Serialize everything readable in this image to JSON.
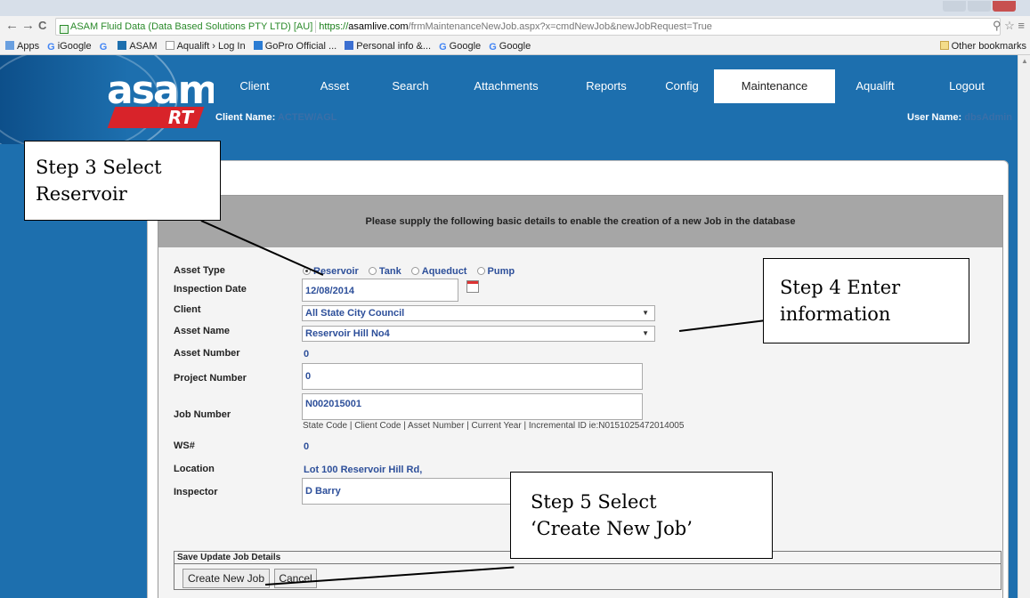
{
  "browser": {
    "ev_label": "ASAM Fluid Data (Data Based Solutions PTY LTD) [AU]",
    "url_scheme": "https://",
    "url_host": "asamlive.com",
    "url_path": "/frmMaintenanceNewJob.aspx?x=cmdNewJob&newJobRequest=True",
    "bookmarks": [
      "Apps",
      "iGoogle",
      "ASAM",
      "Aqualift › Log In",
      "GoPro Official ...",
      "Personal info &...",
      "Google",
      "Google"
    ],
    "other_bookmarks": "Other bookmarks"
  },
  "app": {
    "logo_text": "asam",
    "logo_sub": "RT",
    "nav": [
      "Client",
      "Asset",
      "Search",
      "Attachments",
      "Reports",
      "Config",
      "Maintenance",
      "Aqualift",
      "Logout"
    ],
    "active_nav": "Maintenance",
    "client_label": "Client Name:",
    "client_value": "ACTEW/AGL",
    "user_label": "User Name:",
    "user_value": "dbsAdmin"
  },
  "form": {
    "banner": "Please supply the following basic details to enable the creation of a new Job in the database",
    "labels": {
      "asset_type": "Asset Type",
      "inspection_date": "Inspection Date",
      "client": "Client",
      "asset_name": "Asset Name",
      "asset_number": "Asset Number",
      "project_number": "Project Number",
      "job_number": "Job Number",
      "ws": "WS#",
      "location": "Location",
      "inspector": "Inspector"
    },
    "asset_types": [
      "Reservoir",
      "Tank",
      "Aqueduct",
      "Pump"
    ],
    "selected_asset_type": "Reservoir",
    "inspection_date": "12/08/2014",
    "client": "All State City Council",
    "asset_name": "Reservoir Hill No4",
    "asset_number": "0",
    "project_number": "0",
    "job_number": "N002015001",
    "job_number_hint": "State Code | Client Code | Asset Number | Current Year | Incremental ID ie:N0151025472014005",
    "ws": "0",
    "location": "Lot 100 Reservoir Hill Rd,",
    "inspector": "D Barry",
    "save_legend": "Save Update Job Details",
    "create_button": "Create New Job",
    "cancel_button": "Cancel"
  },
  "callouts": {
    "step3_line1": "Step 3 Select",
    "step3_line2": "Reservoir",
    "step4_line1": "Step 4 Enter",
    "step4_line2": "information",
    "step5_line1": "Step 5 Select",
    "step5_line2": "‘Create New Job’"
  },
  "colors": {
    "app_blue": "#1d6fae",
    "banner_gray": "#a6a6a6",
    "value_blue": "#2d4f9a",
    "logo_red": "#d8232a"
  }
}
